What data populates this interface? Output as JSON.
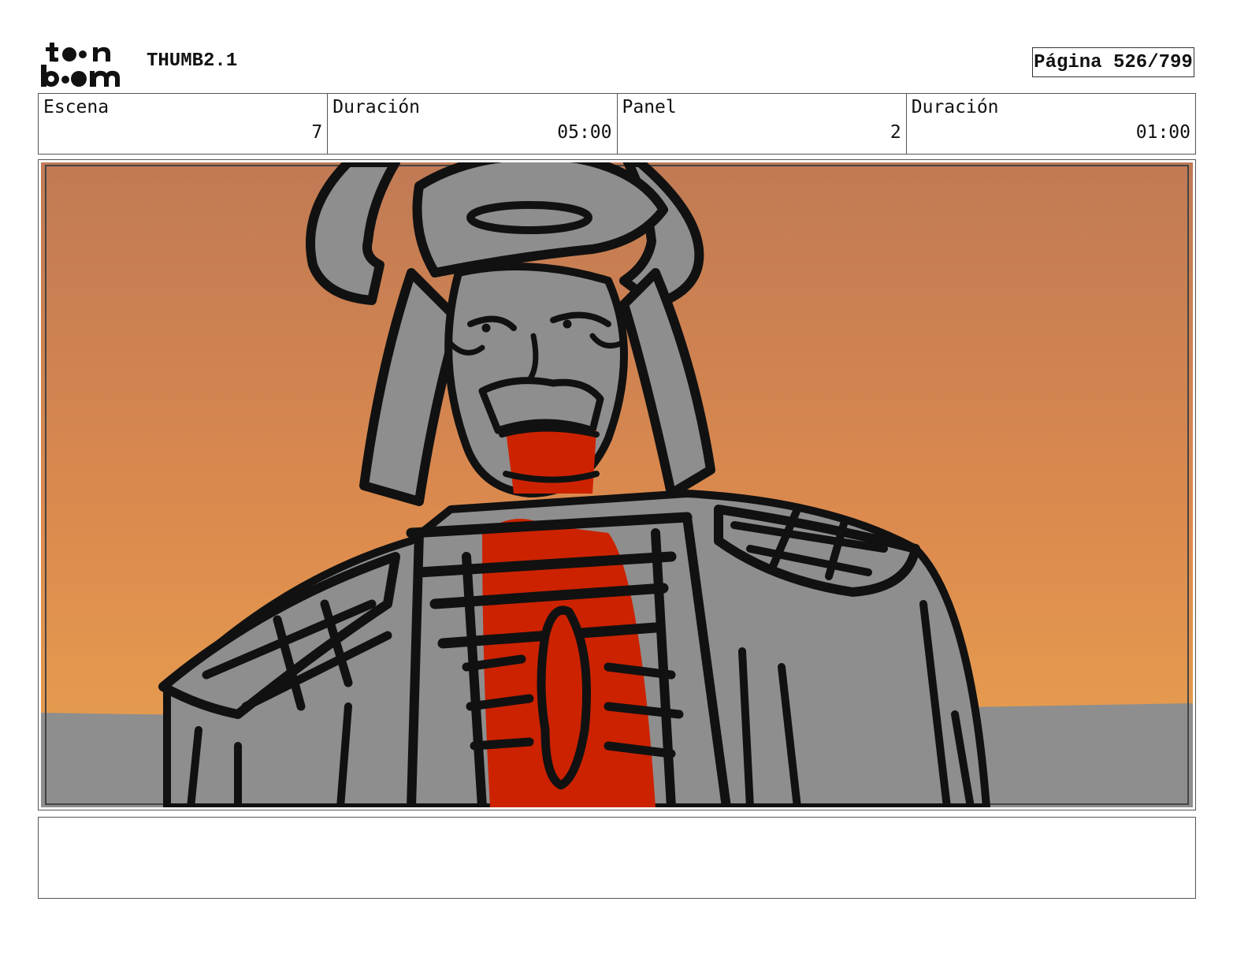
{
  "header": {
    "logo_text": "toon boom",
    "project": "THUMB2.1",
    "page": "Página 526/799"
  },
  "info": {
    "scene_label": "Escena",
    "scene_value": "7",
    "scene_duration_label": "Duración",
    "scene_duration_value": "05:00",
    "panel_label": "Panel",
    "panel_value": "2",
    "panel_duration_label": "Duración",
    "panel_duration_value": "01:00"
  },
  "panel_image": {
    "subject": "samurai-sketch",
    "colors": {
      "sky_top": "#c07a54",
      "sky_bottom": "#e8a24e",
      "armor": "#8e8e8e",
      "ink": "#111111",
      "blood": "#cc2200"
    }
  },
  "notes": {
    "text": ""
  }
}
